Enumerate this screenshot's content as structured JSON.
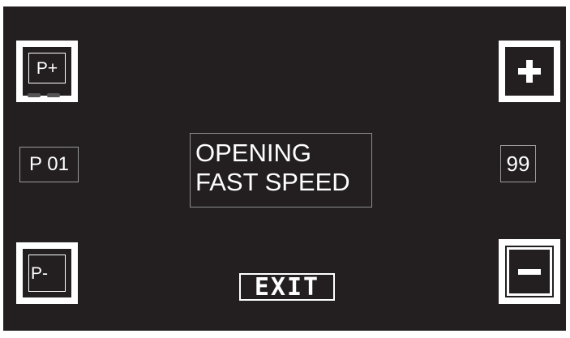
{
  "controls": {
    "program_up_label": "P+",
    "program_down_label": "P-",
    "program_value": "P 01",
    "parameter_value": "99",
    "exit_label": "EXIT",
    "increase_icon": "plus-icon",
    "decrease_icon": "minus-icon"
  },
  "message": {
    "line1": "OPENING",
    "line2": "FAST SPEED"
  },
  "colors": {
    "screen_background": "#231f20",
    "foreground": "#ffffff"
  }
}
